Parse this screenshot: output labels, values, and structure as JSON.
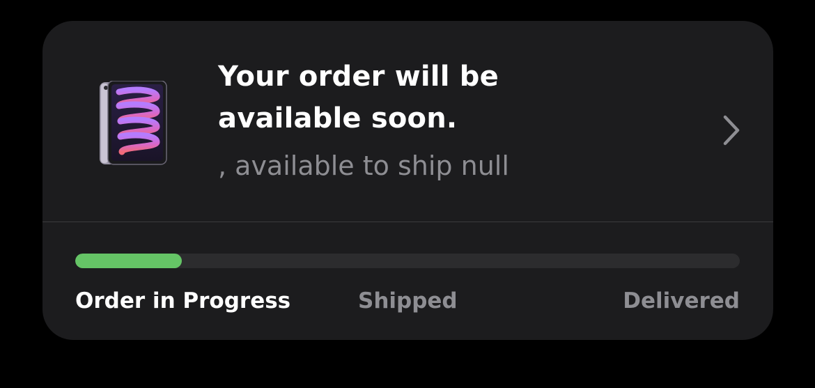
{
  "order": {
    "product_icon": "ipad-mini-purple",
    "headline": "Your order will be available soon.",
    "subline": ", available to ship null",
    "chevron_icon": "chevron-right-icon"
  },
  "progress": {
    "fraction": 0.16,
    "color": "#65c466",
    "stages": [
      {
        "label": "Order in Progress",
        "state": "active"
      },
      {
        "label": "Shipped",
        "state": "inactive"
      },
      {
        "label": "Delivered",
        "state": "inactive"
      }
    ]
  }
}
